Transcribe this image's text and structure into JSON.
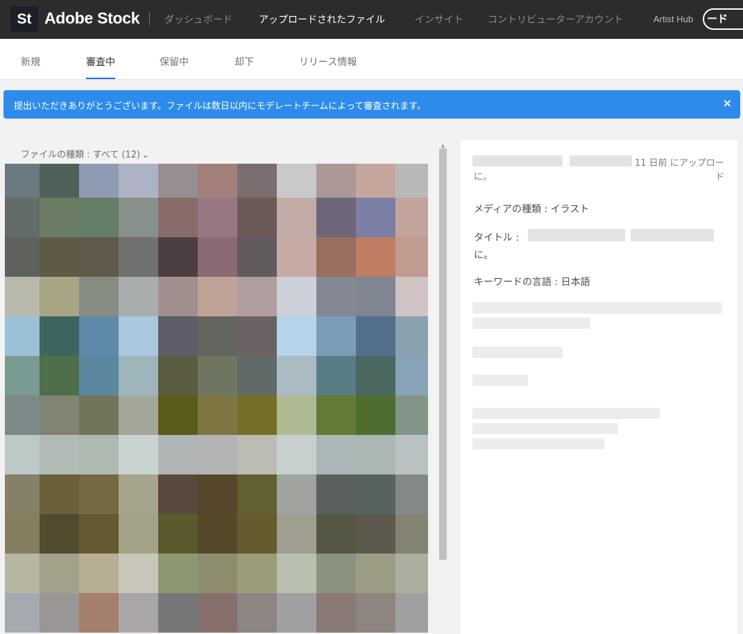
{
  "header": {
    "logo": "St",
    "brand": "Adobe Stock",
    "nav": [
      {
        "label": "ダッシュボード",
        "active": false
      },
      {
        "label": "アップロードされたファイル",
        "active": true
      },
      {
        "label": "インサイト",
        "active": false
      },
      {
        "label": "コントリビューターアカウント",
        "active": false
      }
    ],
    "artist_hub": "Artist Hub",
    "upload_label": "ード"
  },
  "tabs": [
    {
      "label": "新規",
      "active": false
    },
    {
      "label": "審査中",
      "active": true
    },
    {
      "label": "保留中",
      "active": false
    },
    {
      "label": "却下",
      "active": false
    },
    {
      "label": "リリース情報",
      "active": false
    }
  ],
  "alert": {
    "message": "提出いただきありがとうございます。ファイルは数日以内にモデレートチームによって審査されます。",
    "close": "×"
  },
  "filter": {
    "label": "ファイルの種類 : すべて (12)",
    "chevron": "⌄"
  },
  "grid": {
    "colors": [
      [
        "#6b7a80",
        "#4f6259",
        "#8f9bb3",
        "#adb3c5",
        "#978e8f",
        "#a27f7a",
        "#7a6e70",
        "#c9c9c9",
        "#ac9896",
        "#c5a69c",
        "#b8b8b8"
      ],
      [
        "#646c6a",
        "#6b7c64",
        "#667d67",
        "#87908b",
        "#876c6a",
        "#987880",
        "#6b5a58",
        "#c3aca6",
        "#6e6679",
        "#7b7fa6",
        "#c2a49c"
      ],
      [
        "#5f625c",
        "#5f5a46",
        "#615a4d",
        "#717171",
        "#4d3f41",
        "#8a6a73",
        "#625b5e",
        "#c4aca4",
        "#9a6f60",
        "#c07d62",
        "#bf9c8f"
      ],
      [
        "#b8b8ab",
        "#a8a585",
        "#878c82",
        "#a8aeab",
        "#a08f8c",
        "#c0a397",
        "#b09e9f",
        "#cdcfd9",
        "#848794",
        "#808592",
        "#d0c4c4"
      ],
      [
        "#9bc1d6",
        "#3e6660",
        "#5e8aaa",
        "#a9c8df",
        "#5d5c68",
        "#65655f",
        "#6b6263",
        "#b6d3e9",
        "#7b9db8",
        "#536f8c",
        "#8aa1b0"
      ],
      [
        "#7a9a94",
        "#4e6e4c",
        "#5b88a0",
        "#9eb5bb",
        "#5c5c40",
        "#6e7560",
        "#606b69",
        "#abbbc4",
        "#587d87",
        "#4a6860",
        "#88a2b7"
      ],
      [
        "#7c8a88",
        "#818472",
        "#727558",
        "#a3a79a",
        "#5a5c1c",
        "#7e7744",
        "#756f2a",
        "#afba92",
        "#627c38",
        "#4e6e30",
        "#829688"
      ],
      [
        "#bcc9c7",
        "#b1bab4",
        "#aebab1",
        "#c9d3cf",
        "#b1b5b5",
        "#b2b4b3",
        "#bbbdb5",
        "#c8d0ce",
        "#aab7b8",
        "#abb7b4",
        "#b9c1c3"
      ],
      [
        "#868069",
        "#6b603a",
        "#75693f",
        "#a6a48c",
        "#58493c",
        "#55462c",
        "#616132",
        "#a0a39e",
        "#5a6160",
        "#57635f",
        "#838a85"
      ],
      [
        "#857e60",
        "#524b2f",
        "#645933",
        "#a3a287",
        "#5a5a2c",
        "#56492a",
        "#645c2c",
        "#a09e90",
        "#575745",
        "#5b5a4c",
        "#838273"
      ],
      [
        "#b7b6a3",
        "#a3a18a",
        "#b8ae93",
        "#c8c6b9",
        "#8b9870",
        "#8e8c6e",
        "#9a9c7a",
        "#b9c0b0",
        "#8b937f",
        "#9d9c84",
        "#acaea0"
      ],
      [
        "#a4aaaf",
        "#9a9896",
        "#a47f6d",
        "#aaa6a5",
        "#767878",
        "#87706b",
        "#8e8585",
        "#a0a0a2",
        "#8a7b76",
        "#8e8580",
        "#a0a0a0"
      ]
    ]
  },
  "detail": {
    "uploaded_suffix": "11 日前 にアップロー",
    "uploaded_suffix2": "ド",
    "line_ni": "に。",
    "media_type": "メディアの種類 : イラスト",
    "title_label": "タイトル :",
    "title_suffix": "に。",
    "keyword_lang": "キーワードの言語 : 日本語"
  }
}
